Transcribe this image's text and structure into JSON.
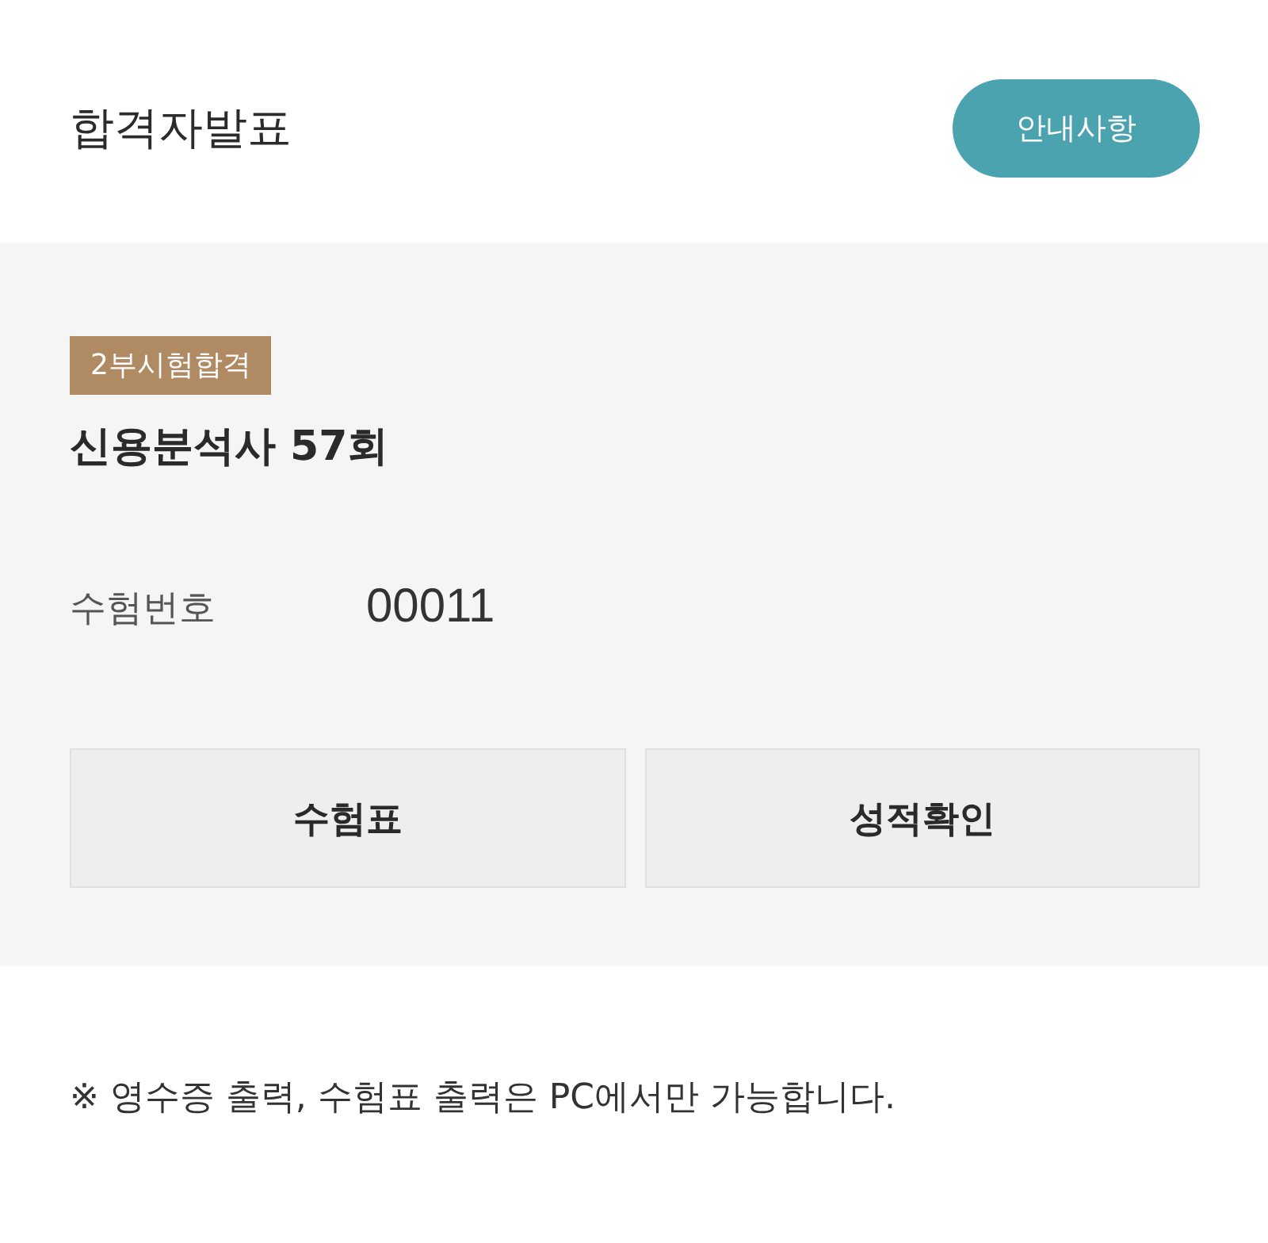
{
  "header": {
    "title": "합격자발표",
    "notice_button": "안내사항"
  },
  "exam": {
    "badge": "2부시험합격",
    "title": "신용분석사 57회",
    "fields": [
      {
        "label": "수험번호",
        "value": "00011"
      }
    ],
    "buttons": [
      "수험표",
      "성적확인"
    ]
  },
  "note": "※ 영수증 출력, 수험표 출력은 PC에서만 가능합니다."
}
